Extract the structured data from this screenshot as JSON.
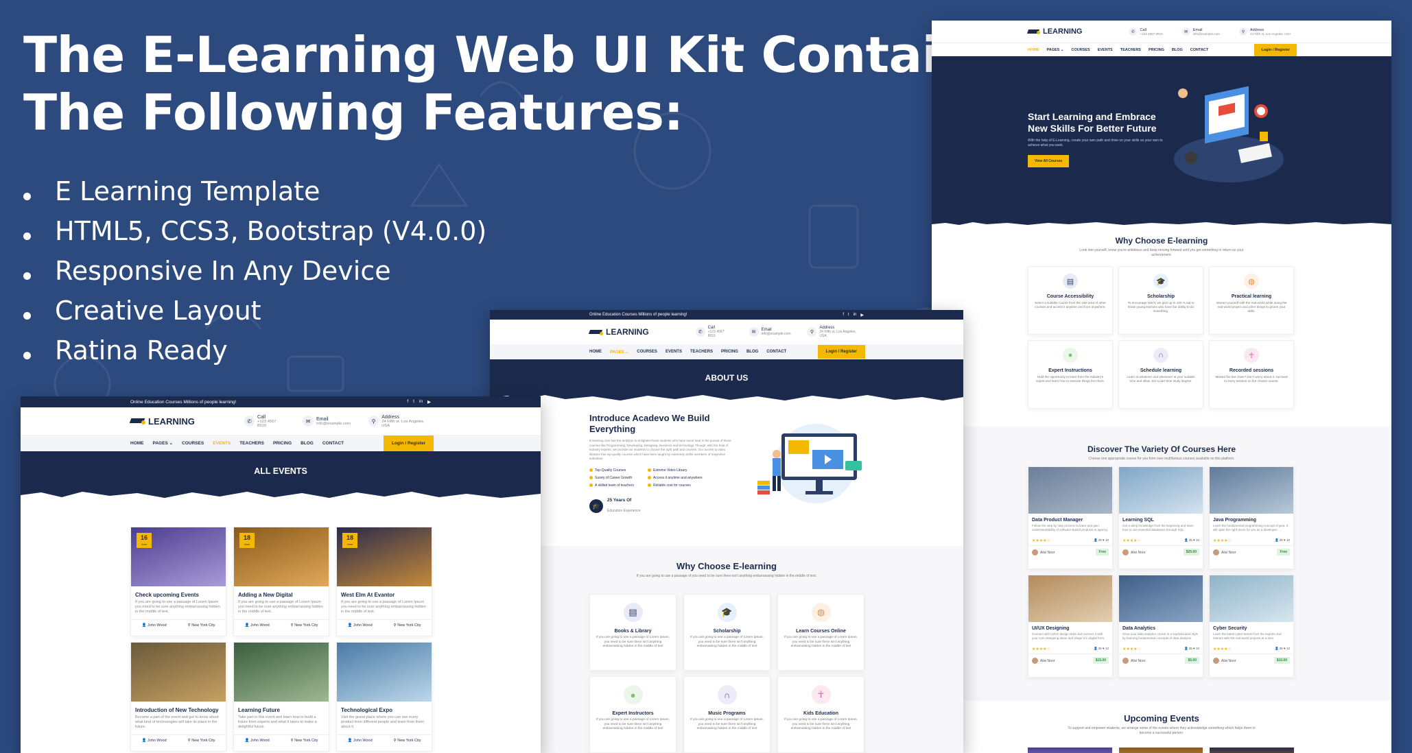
{
  "headline": {
    "line1": "The E-Learning Web UI Kit Contains",
    "line2": "The Following Features:"
  },
  "features": [
    "E Learning Template",
    "HTML5, CCS3, Bootstrap (V4.0.0)",
    "Responsive In Any Device",
    "Creative Layout",
    "Ratina Ready"
  ],
  "common": {
    "topbar_text": "Online Education Courses Millions of people learning!",
    "logo": "LEARNING",
    "call_label": "Call",
    "call_value": "+123 4567 8910",
    "email_label": "Email",
    "email_value": "info@example.com",
    "address_label": "Address",
    "address_value": "24 Fifth st, Los Angeles, USA",
    "nav": [
      "HOME",
      "PAGES ⌄",
      "COURSES",
      "EVENTS",
      "TEACHERS",
      "PRICING",
      "BLOG",
      "CONTACT"
    ],
    "login": "Login / Register",
    "social": [
      "f",
      "t",
      "in",
      "▶"
    ]
  },
  "home": {
    "hero_title_1": "Start Learning and Embrace",
    "hero_title_2": "New Skills For Better Future",
    "hero_text": "With the help of E-Learning, create your own path and drive on your skills on your own to achieve what you seek.",
    "hero_button": "View All Courses",
    "why_title": "Why Choose E-learning",
    "why_sub": "Look into yourself, know you're ambitious and keep moving forward until you get something in return as your achievement.",
    "why_cards": [
      {
        "title": "Course Accessibility",
        "text": "Select a suitable course from the vast area of other courses and access it anytime and from anywhere.",
        "icon": "book-icon",
        "color": "#e8ebf5"
      },
      {
        "title": "Scholarship",
        "text": "To encourage talent, we give up to 100 % aid to those young learners who have the ability to do something.",
        "icon": "graduation-cap-icon",
        "color": "#e6f0fb"
      },
      {
        "title": "Practical learning",
        "text": "Interact yourself with the real-world while doing the real-world project and other things to groom your skills.",
        "icon": "globe-icon",
        "color": "#fdf0e4"
      },
      {
        "title": "Expert Instructions",
        "text": "Hold the opportunity to learn from the industry's expert and learn how to execute things live there.",
        "icon": "user-icon",
        "color": "#eaf6e8"
      },
      {
        "title": "Schedule learning",
        "text": "Learn at whatever and whenever at your suitable time and allow. Set a part-time study degree.",
        "icon": "headphones-icon",
        "color": "#ecebf7"
      },
      {
        "title": "Recorded sessions",
        "text": "Missed the live class? Don't worry about it, succeed to every session on the chosen course.",
        "icon": "child-icon",
        "color": "#fbe8f0"
      }
    ],
    "courses_title": "Discover The Variety Of Courses Here",
    "courses_sub": "Choose one appropriate course for you from over multifarious courses available on this platform.",
    "courses": [
      {
        "title": "Data Product Manager",
        "text": "Follow the step by step process to learn and gain understandability of software-based products in agency.",
        "price": "Free",
        "img1": "#6b7f99",
        "img2": "#a8b6c8"
      },
      {
        "title": "Learning SQL",
        "text": "Get a deep knowledge from the beginning and learn how to use essential databases through SQL.",
        "price": "$25.00",
        "img1": "#7fa7c8",
        "img2": "#d4e2ee"
      },
      {
        "title": "Java Programming",
        "text": "Learn the fundamental programming concept of java. It will open the right doors for you as a developer.",
        "price": "Free",
        "img1": "#5f7a9a",
        "img2": "#b8c9d9"
      },
      {
        "title": "UI/UX Designing",
        "text": "Connect with UI/UX design skills and connect it with your core designing ideas and shape it in digital form.",
        "price": "$15.00",
        "img1": "#b48b5c",
        "img2": "#e2cfb1"
      },
      {
        "title": "Data Analytics",
        "text": "Grow your data analytics career in a sophisticated style by learning fundamental concepts of data analysis.",
        "price": "$5.00",
        "img1": "#3f5f8a",
        "img2": "#8aa4c2"
      },
      {
        "title": "Cyber Security",
        "text": "Learn the latest cyber trends from the experts and interact with the real-world projects at a time.",
        "price": "$10.00",
        "img1": "#8fb3c9",
        "img2": "#d7e6ee"
      }
    ],
    "instructor": "Alisi Noor",
    "stars": "★★★★☆",
    "course_stats": "👤 35  ♥ 10",
    "upcoming_title": "Upcoming Events",
    "upcoming_sub": "To support and empower students, we arrange some of the events where they acknowledge something which helps them to become a successful person."
  },
  "about": {
    "banner": "ABOUT US",
    "intro_title_1": "Introduce Acadevo We Build",
    "intro_title_2": "Everything",
    "intro_text": "E-learning.com has the ambition to enlighten those students who have some heat in the pursuit of these courses like Programming, Developing, Designing, Business and technology. Though, with the help of industry experts, we provide our students to choose the right path and courses. Our access to video libraries has top-quality courses which have been taught by extremely skilful members of respective industries.",
    "checks_left": [
      "Top-Quality Courses",
      "Surety of Career Growth",
      "A skilled team of teachers"
    ],
    "checks_right": [
      "Extreme Video Library",
      "Access it anytime and anywhere",
      "Reliable cost for courses"
    ],
    "years": "25 Years Of",
    "years_sub": "Education Experience",
    "why_title": "Why Choose E-learning",
    "why_sub": "If you are going to use a passage of you need to be sure there isn't anything embarrassing hidden in the middle of text.",
    "card_text": "If you are going to use a passage of Lorem Ipsum, you need to be sure there isn't anything embarrassing hidden in the middle of text",
    "cards": [
      {
        "title": "Books & Library",
        "icon": "book-icon",
        "color": "#e8ebf5"
      },
      {
        "title": "Scholarship",
        "icon": "graduation-cap-icon",
        "color": "#e6f0fb"
      },
      {
        "title": "Learn Courses Online",
        "icon": "globe-icon",
        "color": "#fdf0e4"
      },
      {
        "title": "Expert Instructors",
        "icon": "user-icon",
        "color": "#eaf6e8"
      },
      {
        "title": "Music Programs",
        "icon": "headphones-icon",
        "color": "#ecebf7"
      },
      {
        "title": "Kids Education",
        "icon": "child-icon",
        "color": "#fbe8f0"
      }
    ]
  },
  "events": {
    "banner": "ALL EVENTS",
    "list": [
      {
        "day": "16",
        "month": "June",
        "title": "Check upcoming Events",
        "text": "If you are going to use a passage of Lorem Ipsum you need to be sure anything embarrassing hidden in the middle of text.",
        "img1": "#4b3d8f",
        "img2": "#a99bd8"
      },
      {
        "day": "18",
        "month": "June",
        "title": "Adding a New Digital",
        "text": "If you are going to use a passage of Lorem Ipsum you need to be sure anything embarrassing hidden in the middle of text.",
        "img1": "#8a5a1c",
        "img2": "#e1a85a"
      },
      {
        "day": "18",
        "month": "June",
        "title": "West Elm At Evantor",
        "text": "If you are going to use a passage of Lorem Ipsum you need to be sure anything embarrassing hidden in the middle of text.",
        "img1": "#2a2a4a",
        "img2": "#c58a3a"
      },
      {
        "day": "",
        "month": "",
        "title": "Introduction of New Technology",
        "text": "Become a part of the event and get to know about what kind of technologies will take its place in the future.",
        "img1": "#6a5a3a",
        "img2": "#c8a062"
      },
      {
        "day": "",
        "month": "",
        "title": "Learning Future",
        "text": "Take part in this event and learn how to build a future from experts and what it takes to make a delightful future.",
        "img1": "#3b5e3c",
        "img2": "#9fb894"
      },
      {
        "day": "",
        "month": "",
        "title": "Technological Expo",
        "text": "Visit the grand place where you can see every product from different people and learn from them about it.",
        "img1": "#4a7aa6",
        "img2": "#bcd8ea"
      }
    ],
    "author": "John Wood",
    "location": "New York City"
  }
}
